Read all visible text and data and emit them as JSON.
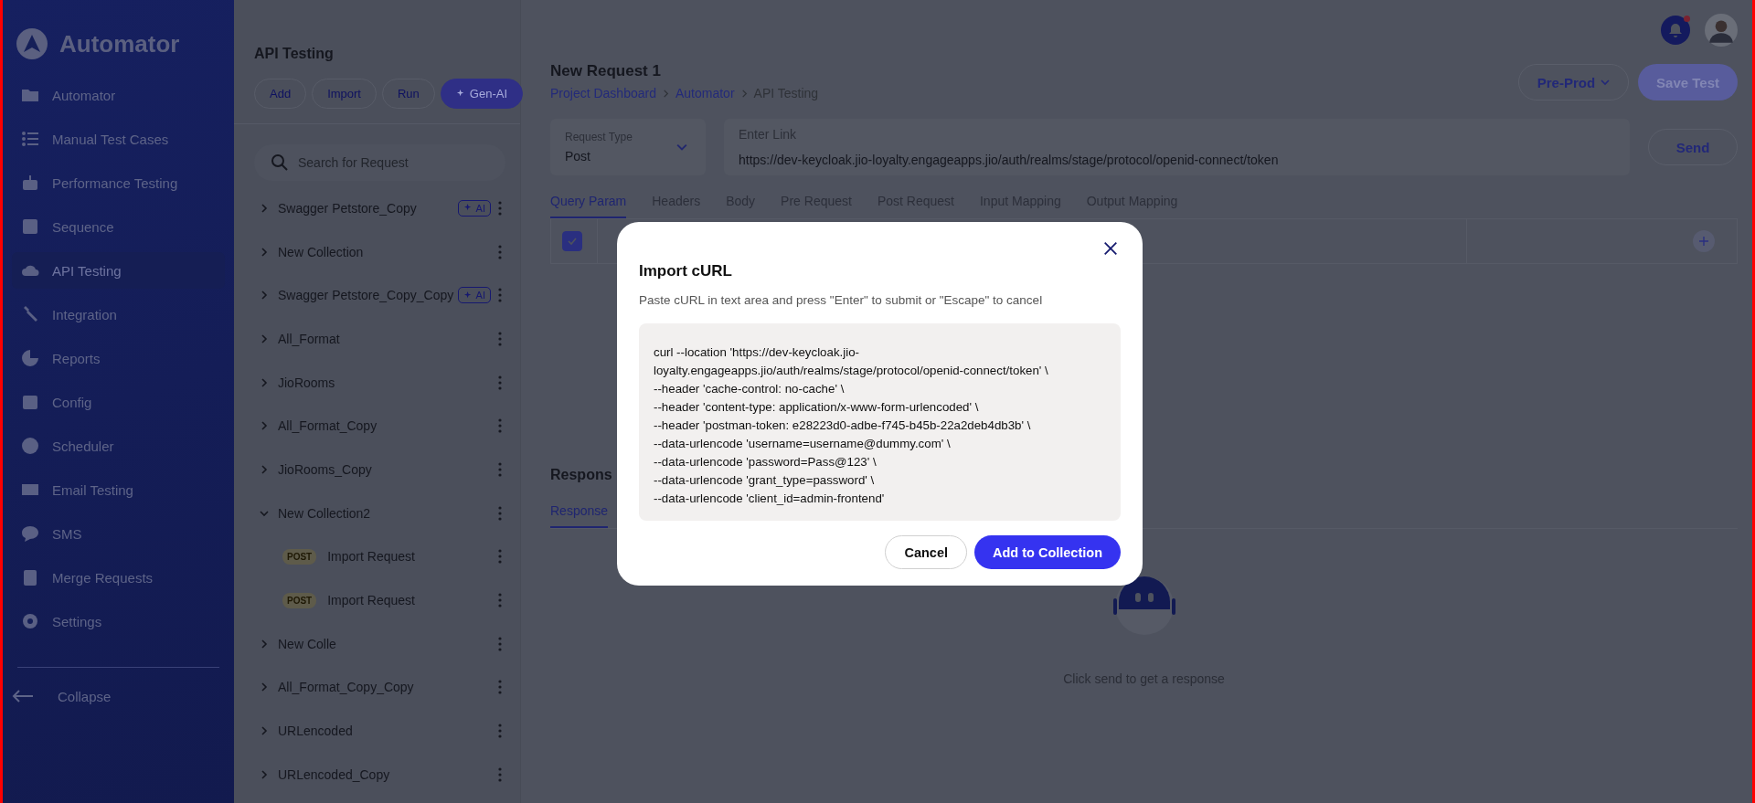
{
  "sidebar": {
    "brand": "Automator",
    "items": [
      {
        "label": "Automator",
        "selected": false
      },
      {
        "label": "Manual Test Cases",
        "selected": false
      },
      {
        "label": "Performance Testing",
        "selected": false
      },
      {
        "label": "Sequence",
        "selected": false
      },
      {
        "label": "API Testing",
        "selected": true
      },
      {
        "label": "Integration",
        "selected": false
      },
      {
        "label": "Reports",
        "selected": false
      },
      {
        "label": "Config",
        "selected": false
      },
      {
        "label": "Scheduler",
        "selected": false
      },
      {
        "label": "Email Testing",
        "selected": false
      },
      {
        "label": "SMS",
        "selected": false
      },
      {
        "label": "Merge Requests",
        "selected": false
      },
      {
        "label": "Settings",
        "selected": false
      }
    ],
    "collapse": "Collapse"
  },
  "collections": {
    "title": "API Testing",
    "actions": [
      "Add",
      "Import",
      "Run"
    ],
    "gen_ai": "Gen-AI",
    "search": {
      "placeholder": "Search for Request"
    },
    "tree": [
      {
        "label": "Swagger Petstore_Copy",
        "expanded": false,
        "badge": "AI"
      },
      {
        "label": "New Collection",
        "expanded": false
      },
      {
        "label": "Swagger Petstore_Copy_Copy",
        "expanded": false,
        "badge": "AI"
      },
      {
        "label": "All_Format",
        "expanded": false
      },
      {
        "label": "JioRooms",
        "expanded": false
      },
      {
        "label": "All_Format_Copy",
        "expanded": false
      },
      {
        "label": "JioRooms_Copy",
        "expanded": false
      },
      {
        "label": "New Collection2",
        "expanded": true,
        "children": [
          {
            "label": "Import Request",
            "method": "POST"
          },
          {
            "label": "Import Request",
            "method": "POST"
          }
        ]
      },
      {
        "label": "New Colle",
        "expanded": false
      },
      {
        "label": "All_Format_Copy_Copy",
        "expanded": false
      },
      {
        "label": "URLencoded",
        "expanded": false
      },
      {
        "label": "URLencoded_Copy",
        "expanded": false
      }
    ]
  },
  "request": {
    "title": "New Request 1",
    "breadcrumb": [
      "Project Dashboard",
      "Automator",
      "API Testing"
    ],
    "environment": "Pre-Prod",
    "save": "Save Test",
    "type_label": "Request Type",
    "type_value": "Post",
    "link_label": "Enter Link",
    "link_value": "https://dev-keycloak.jio-loyalty.engageapps.jio/auth/realms/stage/protocol/openid-connect/token",
    "send": "Send",
    "tabs": [
      {
        "label": "Query Param",
        "selected": true
      },
      {
        "label": "Headers",
        "selected": false
      },
      {
        "label": "Body",
        "selected": false
      },
      {
        "label": "Pre Request",
        "selected": false
      },
      {
        "label": "Post Request",
        "selected": false
      },
      {
        "label": "Input Mapping",
        "selected": false
      },
      {
        "label": "Output Mapping",
        "selected": false
      }
    ],
    "params": [
      {
        "checked": true
      }
    ],
    "response": {
      "title": "Respons",
      "tabs": [
        {
          "label": "Response",
          "selected": true
        }
      ],
      "empty": "Click send to get a response"
    }
  },
  "modal": {
    "title": "Import cURL",
    "hint": "Paste cURL in text area and press \"Enter\" to submit or \"Escape\" to cancel",
    "curl": [
      "curl --location 'https://dev-keycloak.jio-loyalty.engageapps.jio/auth/realms/stage/protocol/openid-connect/token' \\",
      "--header 'cache-control: no-cache' \\",
      "--header 'content-type: application/x-www-form-urlencoded' \\",
      "--header 'postman-token: e28223d0-adbe-f745-b45b-22a2deb4db3b' \\",
      "--data-urlencode 'username=username@dummy.com' \\",
      "--data-urlencode 'password=Pass@123' \\",
      "--data-urlencode 'grant_type=password' \\",
      "--data-urlencode 'client_id=admin-frontend'"
    ],
    "cancel": "Cancel",
    "submit": "Add to Collection"
  }
}
